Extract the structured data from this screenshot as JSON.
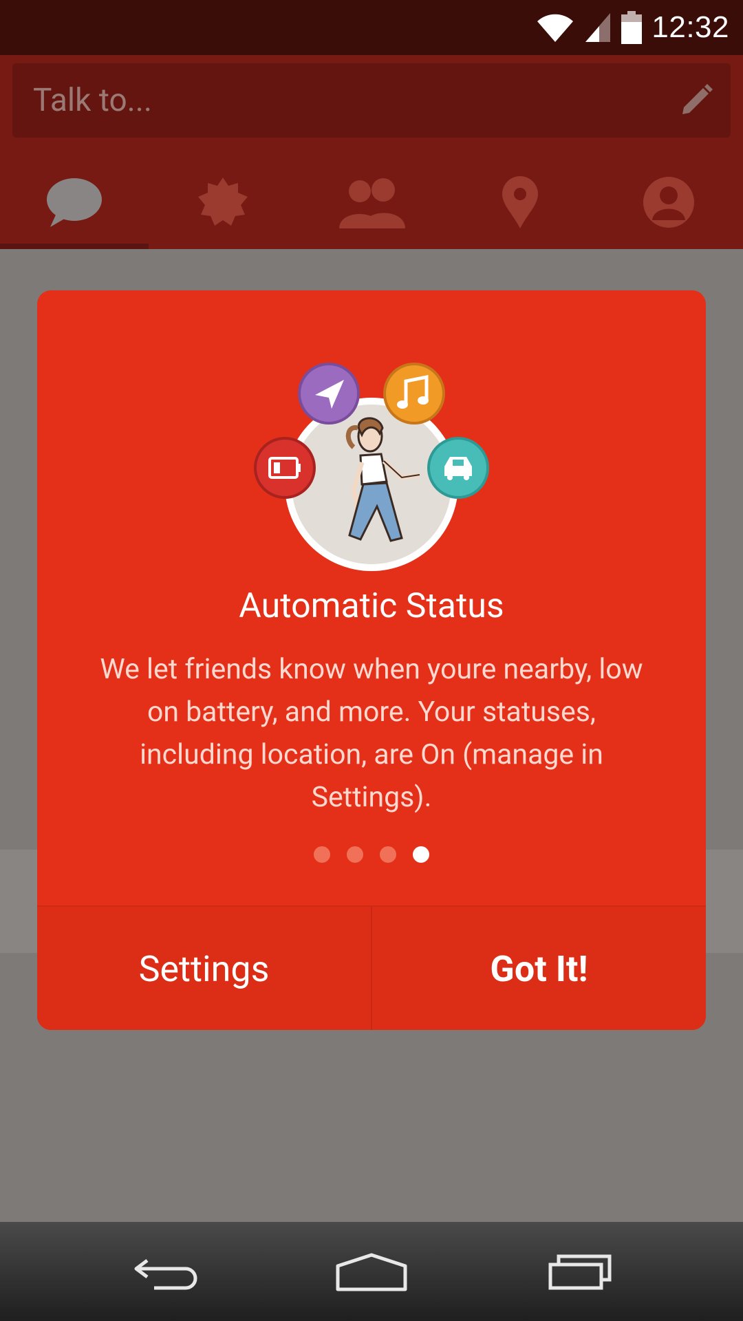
{
  "status_bar": {
    "time": "12:32"
  },
  "search": {
    "placeholder": "Talk to..."
  },
  "tabs": [
    {
      "name": "messages",
      "icon": "chat-bubble-icon",
      "active": true
    },
    {
      "name": "notifications",
      "icon": "badge-icon",
      "active": false
    },
    {
      "name": "friends",
      "icon": "people-icon",
      "active": false
    },
    {
      "name": "places",
      "icon": "location-pin-icon",
      "active": false
    },
    {
      "name": "profile",
      "icon": "profile-icon",
      "active": false
    }
  ],
  "dialog": {
    "title": "Automatic Status",
    "body": "We let friends know when youre nearby, low on battery, and more. Your statuses, including location, are On (manage in Settings).",
    "page_index": 4,
    "page_count": 4,
    "buttons": {
      "settings": "Settings",
      "got_it": "Got It!"
    }
  },
  "colors": {
    "dialog_bg": "#e53019",
    "header_dimmed": "#761a13",
    "purple_badge": "#9b6bbf",
    "orange_badge": "#f19a25",
    "teal_badge": "#48bdb8",
    "red_badge": "#d9312b"
  }
}
